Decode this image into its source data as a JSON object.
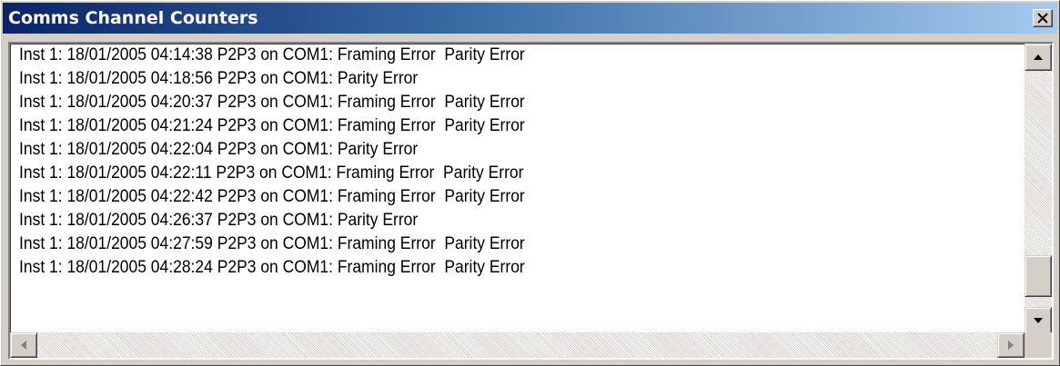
{
  "window": {
    "title": "Comms Channel Counters",
    "close_label": "×"
  },
  "log": {
    "lines": [
      "Inst 1: 18/01/2005 04:14:38 P2P3 on COM1: Framing Error  Parity Error",
      "Inst 1: 18/01/2005 04:18:56 P2P3 on COM1: Parity Error",
      "Inst 1: 18/01/2005 04:20:37 P2P3 on COM1: Framing Error  Parity Error",
      "Inst 1: 18/01/2005 04:21:24 P2P3 on COM1: Framing Error  Parity Error",
      "Inst 1: 18/01/2005 04:22:04 P2P3 on COM1: Parity Error",
      "Inst 1: 18/01/2005 04:22:11 P2P3 on COM1: Framing Error  Parity Error",
      "Inst 1: 18/01/2005 04:22:42 P2P3 on COM1: Framing Error  Parity Error",
      "Inst 1: 18/01/2005 04:26:37 P2P3 on COM1: Parity Error",
      "Inst 1: 18/01/2005 04:27:59 P2P3 on COM1: Framing Error  Parity Error",
      "Inst 1: 18/01/2005 04:28:24 P2P3 on COM1: Framing Error  Parity Error"
    ]
  },
  "scrollbars": {
    "vertical_position_fraction": 0.95,
    "horizontal_position_fraction": 0.0
  },
  "colors": {
    "title_gradient_start": "#0a246a",
    "title_gradient_end": "#a6caf0",
    "face": "#d4d0c8"
  },
  "icons": {
    "close": "close-icon",
    "scroll_up": "arrow-up-icon",
    "scroll_down": "arrow-down-icon",
    "scroll_left": "arrow-left-icon",
    "scroll_right": "arrow-right-icon"
  }
}
